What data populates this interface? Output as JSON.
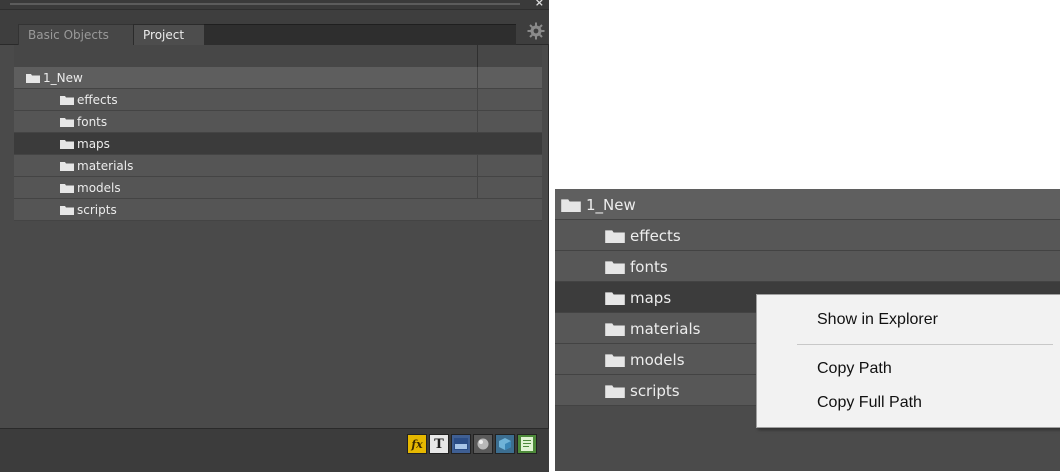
{
  "tabs": [
    {
      "label": "Basic Objects"
    },
    {
      "label": "Project"
    }
  ],
  "tree": {
    "root": "1_New",
    "children": [
      "effects",
      "fonts",
      "maps",
      "materials",
      "models",
      "scripts"
    ],
    "selected": "maps"
  },
  "toolbar": {
    "fx_label": "fx",
    "text_label": "T"
  },
  "context_menu": {
    "items": [
      "Show in Explorer",
      "Copy Path",
      "Copy Full Path"
    ]
  },
  "icons": [
    "gear-icon",
    "folder-icon",
    "close-icon",
    "fx-icon",
    "text-icon",
    "image-icon",
    "sphere-icon",
    "cube-icon",
    "script-icon"
  ],
  "colors": {
    "panel_bg": "#4a4a4a",
    "row_bg": "#555555",
    "selected_row_bg": "#3b3b3b",
    "menu_bg": "#f2f2f2",
    "fx_accent": "#e6b800"
  }
}
